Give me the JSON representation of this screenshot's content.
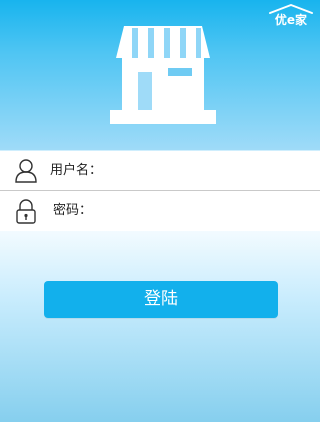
{
  "brand": {
    "logo_text": "优e家"
  },
  "form": {
    "username_label": "用户名：",
    "username_value": "",
    "password_label": "密码：",
    "password_value": ""
  },
  "actions": {
    "login_label": "登陆"
  },
  "icons": {
    "shop": "shop-icon",
    "user": "user-icon",
    "lock": "lock-icon",
    "brand": "brand-logo"
  },
  "colors": {
    "accent": "#12b0ec",
    "header_top": "#18b4ee",
    "header_bottom": "#9fdbf8",
    "field_bg": "#ffffff",
    "divider": "#c9c9c9"
  }
}
